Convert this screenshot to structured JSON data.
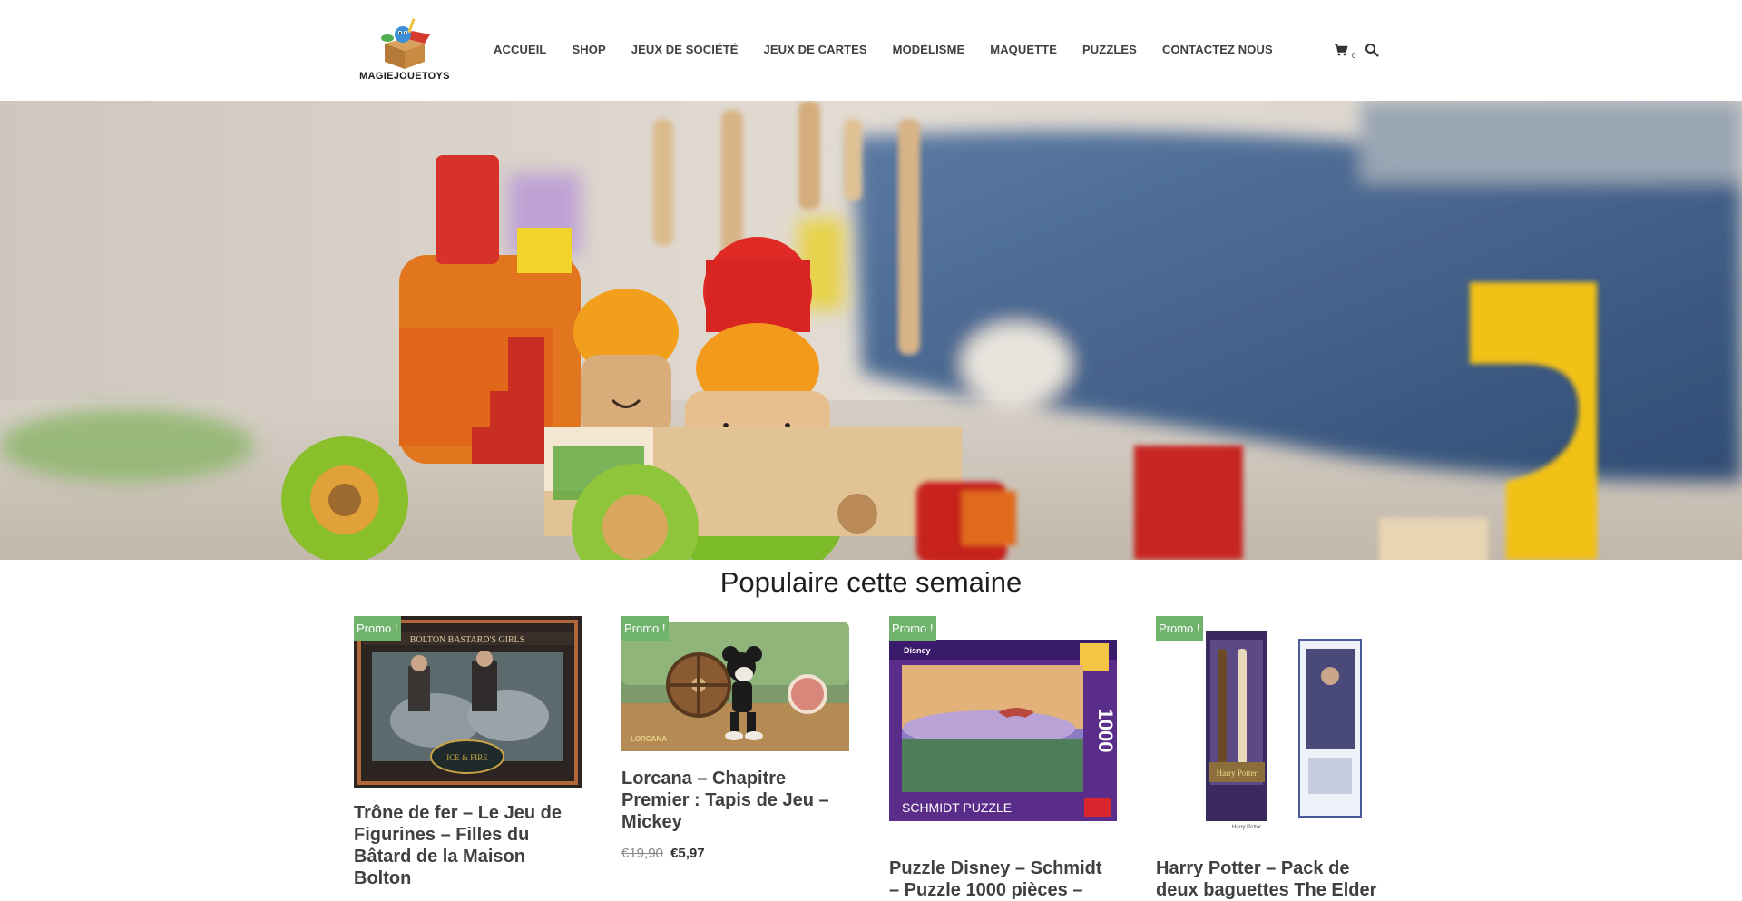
{
  "brand": {
    "name": "MAGIEJOUETOYS"
  },
  "nav": {
    "items": [
      {
        "label": "ACCUEIL"
      },
      {
        "label": "SHOP"
      },
      {
        "label": "JEUX DE SOCIÉTÉ"
      },
      {
        "label": "JEUX DE CARTES"
      },
      {
        "label": "MODÉLISME"
      },
      {
        "label": "MAQUETTE"
      },
      {
        "label": "PUZZLES"
      },
      {
        "label": "CONTACTEZ NOUS"
      }
    ],
    "cart_count": "0",
    "icons": [
      "cart-icon",
      "search-icon"
    ]
  },
  "hero": {
    "image": "wooden-toy-train-photo"
  },
  "section": {
    "title": "Populaire cette semaine"
  },
  "products": [
    {
      "badge": "Promo !",
      "name": "Trône de fer – Le Jeu de Figurines – Filles du Bâtard de la Maison Bolton",
      "image": "bolton-bastards-girls-box"
    },
    {
      "badge": "Promo !",
      "name": "Lorcana – Chapitre Premier : Tapis de Jeu – Mickey",
      "old_price": "€19,90",
      "new_price": "€5,97",
      "image": "lorcana-mickey-playmat"
    },
    {
      "badge": "Promo !",
      "name": "Puzzle Disney – Schmidt – Puzzle 1000 pièces –",
      "image": "schmidt-disney-puzzle-box"
    },
    {
      "badge": "Promo !",
      "name": "Harry Potter – Pack de deux baguettes The Elder",
      "image": "harry-potter-wands-pack"
    }
  ],
  "colors": {
    "promo_badge": "#6fb36d",
    "nav_text": "#404040",
    "title_text": "#1f1f1f"
  }
}
